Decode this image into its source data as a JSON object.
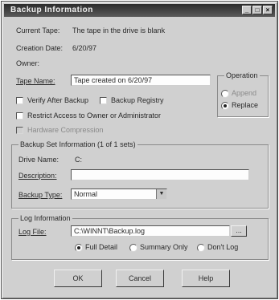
{
  "window": {
    "title": "Backup Information"
  },
  "tape": {
    "current_tape_label": "Current Tape:",
    "current_tape_value": "The tape in the drive is blank",
    "creation_date_label": "Creation Date:",
    "creation_date_value": "6/20/97",
    "owner_label": "Owner:",
    "tape_name_label": "Tape Name:",
    "tape_name_value": "Tape created on 6/20/97"
  },
  "options": {
    "verify_label": "Verify After Backup",
    "registry_label": "Backup Registry",
    "restrict_label": "Restrict Access to Owner or Administrator",
    "hardware_label": "Hardware Compression"
  },
  "operation": {
    "title": "Operation",
    "append_label": "Append",
    "replace_label": "Replace",
    "selected": "Replace"
  },
  "backup_set": {
    "title": "Backup Set Information (1 of 1 sets)",
    "drive_name_label": "Drive Name:",
    "drive_name_value": "C:",
    "description_label": "Description:",
    "description_value": "",
    "backup_type_label": "Backup Type:",
    "backup_type_value": "Normal"
  },
  "log": {
    "title": "Log Information",
    "log_file_label": "Log File:",
    "log_file_value": "C:\\WINNT\\Backup.log",
    "browse_label": "...",
    "full_detail_label": "Full Detail",
    "summary_only_label": "Summary Only",
    "dont_log_label": "Don't Log",
    "selected": "Full Detail"
  },
  "buttons": {
    "ok": "OK",
    "cancel": "Cancel",
    "help": "Help"
  }
}
